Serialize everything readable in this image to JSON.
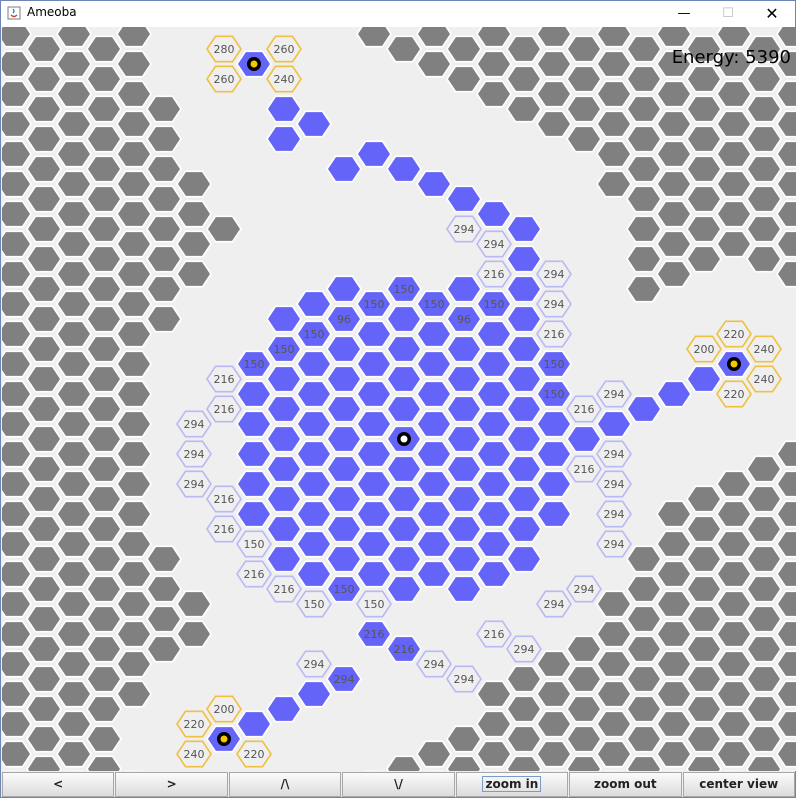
{
  "window": {
    "title": "Ameoba",
    "minimize_glyph": "—",
    "maximize_glyph": "☐",
    "close_glyph": "✕",
    "icon": "java-icon"
  },
  "hud": {
    "energy_label": "Energy: 5390"
  },
  "toolbar": {
    "left_label": "<",
    "right_label": ">",
    "up_label": "/\\",
    "down_label": "\\/",
    "zoom_in_label": "zoom in",
    "zoom_out_label": "zoom out",
    "center_view_label": "center view"
  },
  "colors": {
    "background": "#efefef",
    "rock": "#808080",
    "ameoba": "#6464f8",
    "frontier": "#b9b9f5",
    "food_frontier": "#f0c040",
    "nucleus_outer": "#000000",
    "nucleus_food": "#f7c600",
    "nucleus_core": "#ffffff"
  },
  "nuclei": [
    {
      "kind": "food",
      "col": 8,
      "row": 1
    },
    {
      "kind": "core",
      "col": 13,
      "row": 13
    },
    {
      "kind": "food",
      "col": 24,
      "row": 11
    },
    {
      "kind": "food",
      "col": 7,
      "row": 23
    }
  ],
  "food_labels": [
    {
      "col": 7,
      "row": 0,
      "text": "280"
    },
    {
      "col": 9,
      "row": 0,
      "text": "260"
    },
    {
      "col": 7,
      "row": 1,
      "text": "260"
    },
    {
      "col": 9,
      "row": 1,
      "text": "240"
    },
    {
      "col": 23,
      "row": 10,
      "text": "200"
    },
    {
      "col": 24,
      "row": 10,
      "text": "220"
    },
    {
      "col": 25,
      "row": 10,
      "text": "240"
    },
    {
      "col": 25,
      "row": 11,
      "text": "240"
    },
    {
      "col": 24,
      "row": 12,
      "text": "220"
    },
    {
      "col": 7,
      "row": 22,
      "text": "200"
    },
    {
      "col": 6,
      "row": 23,
      "text": "220"
    },
    {
      "col": 6,
      "row": 24,
      "text": "240"
    },
    {
      "col": 8,
      "row": 24,
      "text": "220"
    },
    {
      "col": 7,
      "row": 25,
      "text": "240"
    }
  ],
  "frontier_labels": [
    {
      "col": 15,
      "row": 6,
      "text": "294"
    },
    {
      "col": 16,
      "row": 7,
      "text": "294"
    },
    {
      "col": 16,
      "row": 8,
      "text": "216"
    },
    {
      "col": 18,
      "row": 8,
      "text": "294"
    },
    {
      "col": 13,
      "row": 8,
      "text": "150"
    },
    {
      "col": 12,
      "row": 9,
      "text": "150"
    },
    {
      "col": 14,
      "row": 9,
      "text": "150"
    },
    {
      "col": 16,
      "row": 9,
      "text": "150"
    },
    {
      "col": 18,
      "row": 9,
      "text": "294"
    },
    {
      "col": 11,
      "row": 9,
      "text": "96"
    },
    {
      "col": 15,
      "row": 9,
      "text": "96"
    },
    {
      "col": 10,
      "row": 10,
      "text": "150"
    },
    {
      "col": 18,
      "row": 10,
      "text": "216"
    },
    {
      "col": 9,
      "row": 10,
      "text": "150"
    },
    {
      "col": 8,
      "row": 11,
      "text": "150"
    },
    {
      "col": 18,
      "row": 11,
      "text": "150"
    },
    {
      "col": 7,
      "row": 11,
      "text": "216"
    },
    {
      "col": 18,
      "row": 12,
      "text": "150"
    },
    {
      "col": 20,
      "row": 12,
      "text": "294"
    },
    {
      "col": 7,
      "row": 12,
      "text": "216"
    },
    {
      "col": 19,
      "row": 12,
      "text": "216"
    },
    {
      "col": 6,
      "row": 13,
      "text": "294"
    },
    {
      "col": 20,
      "row": 14,
      "text": "294"
    },
    {
      "col": 6,
      "row": 14,
      "text": "294"
    },
    {
      "col": 19,
      "row": 14,
      "text": "216"
    },
    {
      "col": 6,
      "row": 15,
      "text": "294"
    },
    {
      "col": 20,
      "row": 15,
      "text": "294"
    },
    {
      "col": 7,
      "row": 15,
      "text": "216"
    },
    {
      "col": 20,
      "row": 16,
      "text": "294"
    },
    {
      "col": 7,
      "row": 16,
      "text": "216"
    },
    {
      "col": 8,
      "row": 17,
      "text": "150"
    },
    {
      "col": 20,
      "row": 17,
      "text": "294"
    },
    {
      "col": 8,
      "row": 18,
      "text": "216"
    },
    {
      "col": 19,
      "row": 18,
      "text": "294"
    },
    {
      "col": 9,
      "row": 18,
      "text": "216"
    },
    {
      "col": 11,
      "row": 18,
      "text": "150"
    },
    {
      "col": 10,
      "row": 19,
      "text": "150"
    },
    {
      "col": 12,
      "row": 19,
      "text": "150"
    },
    {
      "col": 18,
      "row": 19,
      "text": "294"
    },
    {
      "col": 13,
      "row": 20,
      "text": "216"
    },
    {
      "col": 17,
      "row": 20,
      "text": "294"
    },
    {
      "col": 12,
      "row": 20,
      "text": "216"
    },
    {
      "col": 16,
      "row": 20,
      "text": "216"
    },
    {
      "col": 11,
      "row": 21,
      "text": "294"
    },
    {
      "col": 15,
      "row": 21,
      "text": "294"
    },
    {
      "col": 10,
      "row": 21,
      "text": "294"
    },
    {
      "col": 14,
      "row": 21,
      "text": "294"
    }
  ]
}
